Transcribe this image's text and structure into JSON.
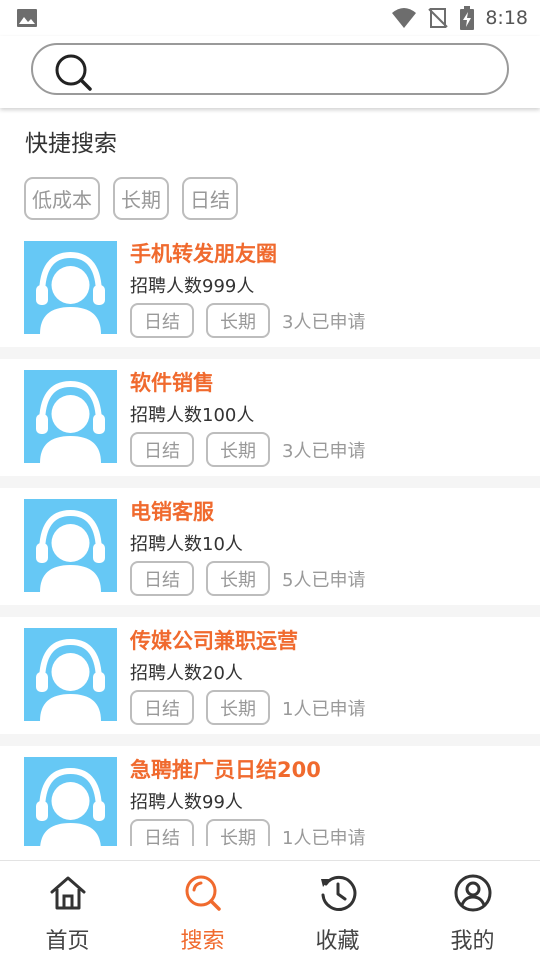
{
  "status_bar": {
    "time": "8:18"
  },
  "search": {
    "placeholder": "",
    "value": ""
  },
  "quick_search": {
    "title": "快捷搜索",
    "tags": [
      "低成本",
      "长期",
      "日结"
    ]
  },
  "jobs": [
    {
      "title": "手机转发朋友圈",
      "count": "招聘人数999人",
      "tags": [
        "日结",
        "长期"
      ],
      "applied": "3人已申请"
    },
    {
      "title": "软件销售",
      "count": "招聘人数100人",
      "tags": [
        "日结",
        "长期"
      ],
      "applied": "3人已申请"
    },
    {
      "title": "电销客服",
      "count": "招聘人数10人",
      "tags": [
        "日结",
        "长期"
      ],
      "applied": "5人已申请"
    },
    {
      "title": "传媒公司兼职运营",
      "count": "招聘人数20人",
      "tags": [
        "日结",
        "长期"
      ],
      "applied": "1人已申请"
    },
    {
      "title": "急聘推广员日结200",
      "count": "招聘人数99人",
      "tags": [
        "日结",
        "长期"
      ],
      "applied": "1人已申请"
    }
  ],
  "nav": {
    "items": [
      {
        "label": "首页",
        "icon": "home-icon"
      },
      {
        "label": "搜索",
        "icon": "search-icon"
      },
      {
        "label": "收藏",
        "icon": "history-icon"
      },
      {
        "label": "我的",
        "icon": "user-icon"
      }
    ],
    "active": "搜索"
  },
  "colors": {
    "accent": "#f06a2e",
    "avatar_bg": "#66c8f5",
    "tag_border": "#bdbdbd"
  }
}
